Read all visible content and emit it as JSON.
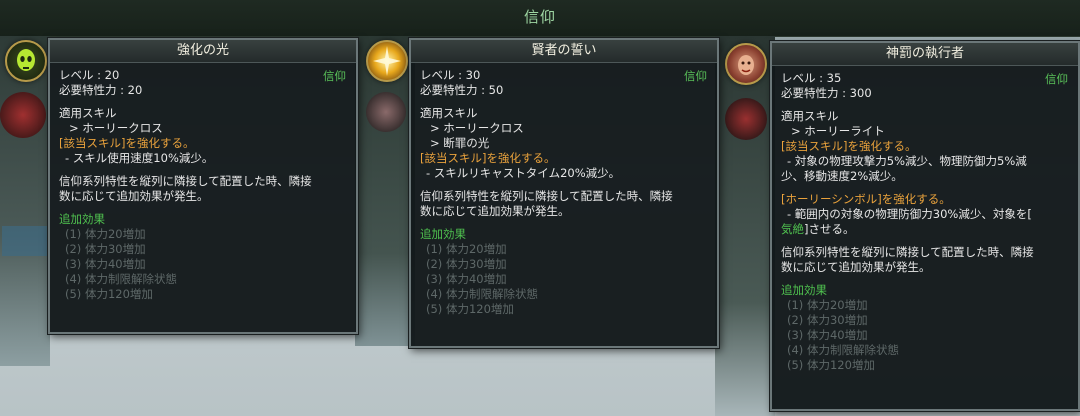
{
  "header": {
    "title": "信仰"
  },
  "cards": [
    {
      "title": "強化の光",
      "category": "信仰",
      "level": "レベル : 20",
      "required": "必要特性力 : 20",
      "skill_header": "適用スキル",
      "skills": [
        "> ホーリークロス"
      ],
      "effect1": "[該当スキル]を強化する。",
      "effect1_details": [
        "- スキル使用速度10%減少。"
      ],
      "series_line1": "信仰系列特性を縦列に隣接して配置した時、隣接",
      "series_line2": "数に応じて追加効果が発生。",
      "bonus_header": "追加効果",
      "bonus": [
        "(1) 体力20増加",
        "(2) 体力30増加",
        "(3) 体力40増加",
        "(4) 体力制限解除状態",
        "(5) 体力120増加"
      ]
    },
    {
      "title": "賢者の誓い",
      "category": "信仰",
      "level": "レベル : 30",
      "required": "必要特性力 : 50",
      "skill_header": "適用スキル",
      "skills": [
        "> ホーリークロス",
        "> 断罪の光"
      ],
      "effect1": "[該当スキル]を強化する。",
      "effect1_details": [
        "- スキルリキャストタイム20%減少。"
      ],
      "series_line1": "信仰系列特性を縦列に隣接して配置した時、隣接",
      "series_line2": "数に応じて追加効果が発生。",
      "bonus_header": "追加効果",
      "bonus": [
        "(1) 体力20増加",
        "(2) 体力30増加",
        "(3) 体力40増加",
        "(4) 体力制限解除状態",
        "(5) 体力120増加"
      ]
    },
    {
      "title": "神罰の執行者",
      "category": "信仰",
      "level": "レベル : 35",
      "required": "必要特性力 : 300",
      "skill_header": "適用スキル",
      "skills": [
        "> ホーリーライト"
      ],
      "effect1": "[該当スキル]を強化する。",
      "effect1_details": [
        "- 対象の物理攻撃力5%減少、物理防御力5%減",
        "少、移動速度2%減少。"
      ],
      "effect2": "[ホーリーシンボル]を強化する。",
      "effect2_line1": "- 範囲内の対象の物理防御力30%減少、対象を[",
      "effect2_line2_green": "気絶",
      "effect2_line2_rest": "]させる。",
      "series_line1": "信仰系列特性を縦列に隣接して配置した時、隣接",
      "series_line2": "数に応じて追加効果が発生。",
      "bonus_header": "追加効果",
      "bonus": [
        "(1) 体力20増加",
        "(2) 体力30増加",
        "(3) 体力40増加",
        "(4) 体力制限解除状態",
        "(5) 体力120増加"
      ]
    }
  ],
  "icons": [
    "green-skull-icon",
    "golden-starburst-icon",
    "red-face-icon"
  ]
}
